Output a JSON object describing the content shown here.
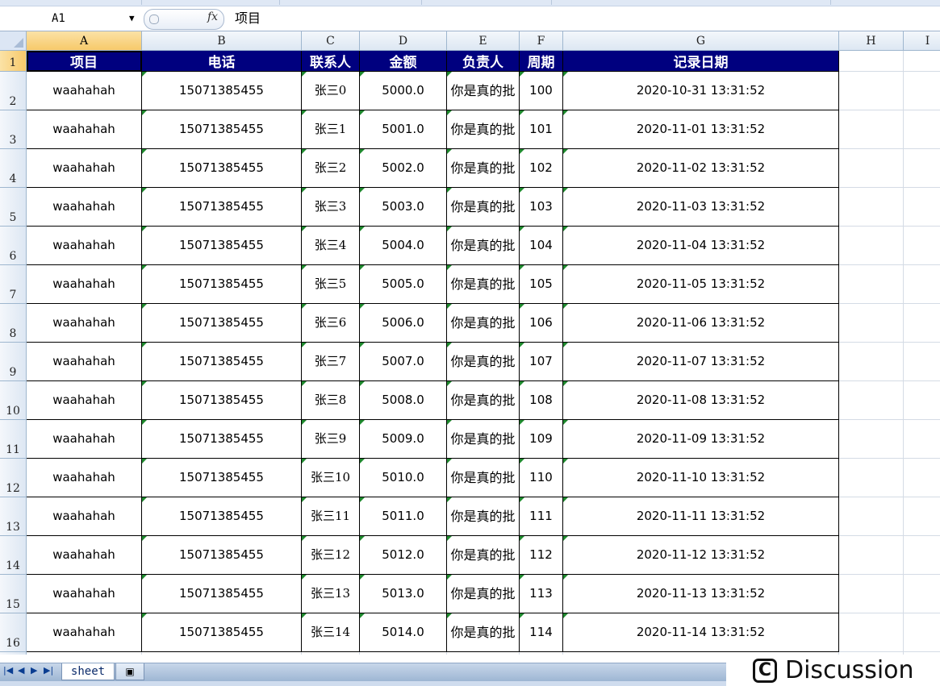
{
  "name_box": "A1",
  "formula_content": "项目",
  "columns": [
    "A",
    "B",
    "C",
    "D",
    "E",
    "F",
    "G",
    "H",
    "I"
  ],
  "header_row": [
    "项目",
    "电话",
    "联系人",
    "金额",
    "负责人",
    "周期",
    "记录日期"
  ],
  "rows": [
    {
      "num": "2",
      "cells": [
        "waahahah",
        "15071385455",
        "张三0",
        "5000.0",
        "你是真的批",
        "100",
        "2020-10-31 13:31:52"
      ]
    },
    {
      "num": "3",
      "cells": [
        "waahahah",
        "15071385455",
        "张三1",
        "5001.0",
        "你是真的批",
        "101",
        "2020-11-01 13:31:52"
      ]
    },
    {
      "num": "4",
      "cells": [
        "waahahah",
        "15071385455",
        "张三2",
        "5002.0",
        "你是真的批",
        "102",
        "2020-11-02 13:31:52"
      ]
    },
    {
      "num": "5",
      "cells": [
        "waahahah",
        "15071385455",
        "张三3",
        "5003.0",
        "你是真的批",
        "103",
        "2020-11-03 13:31:52"
      ]
    },
    {
      "num": "6",
      "cells": [
        "waahahah",
        "15071385455",
        "张三4",
        "5004.0",
        "你是真的批",
        "104",
        "2020-11-04 13:31:52"
      ]
    },
    {
      "num": "7",
      "cells": [
        "waahahah",
        "15071385455",
        "张三5",
        "5005.0",
        "你是真的批",
        "105",
        "2020-11-05 13:31:52"
      ]
    },
    {
      "num": "8",
      "cells": [
        "waahahah",
        "15071385455",
        "张三6",
        "5006.0",
        "你是真的批",
        "106",
        "2020-11-06 13:31:52"
      ]
    },
    {
      "num": "9",
      "cells": [
        "waahahah",
        "15071385455",
        "张三7",
        "5007.0",
        "你是真的批",
        "107",
        "2020-11-07 13:31:52"
      ]
    },
    {
      "num": "10",
      "cells": [
        "waahahah",
        "15071385455",
        "张三8",
        "5008.0",
        "你是真的批",
        "108",
        "2020-11-08 13:31:52"
      ]
    },
    {
      "num": "11",
      "cells": [
        "waahahah",
        "15071385455",
        "张三9",
        "5009.0",
        "你是真的批",
        "109",
        "2020-11-09 13:31:52"
      ]
    },
    {
      "num": "12",
      "cells": [
        "waahahah",
        "15071385455",
        "张三10",
        "5010.0",
        "你是真的批",
        "110",
        "2020-11-10 13:31:52"
      ]
    },
    {
      "num": "13",
      "cells": [
        "waahahah",
        "15071385455",
        "张三11",
        "5011.0",
        "你是真的批",
        "111",
        "2020-11-11 13:31:52"
      ]
    },
    {
      "num": "14",
      "cells": [
        "waahahah",
        "15071385455",
        "张三12",
        "5012.0",
        "你是真的批",
        "112",
        "2020-11-12 13:31:52"
      ]
    },
    {
      "num": "15",
      "cells": [
        "waahahah",
        "15071385455",
        "张三13",
        "5013.0",
        "你是真的批",
        "113",
        "2020-11-13 13:31:52"
      ]
    },
    {
      "num": "16",
      "cells": [
        "waahahah",
        "15071385455",
        "张三14",
        "5014.0",
        "你是真的批",
        "114",
        "2020-11-14 13:31:52"
      ]
    }
  ],
  "sheet_tabs": [
    "sheet"
  ],
  "watermark": "Discussion",
  "icons": {
    "namebox_dropdown": "chevron-down-icon",
    "function": "fx-icon",
    "new_sheet": "insert-sheet-icon",
    "watermark": "discussion-logo-icon"
  },
  "colors": {
    "header_fill": "#00007f",
    "header_text": "#ffffff",
    "selected_heading": "#f7c96a",
    "comment_marker": "#1f8a2e"
  }
}
